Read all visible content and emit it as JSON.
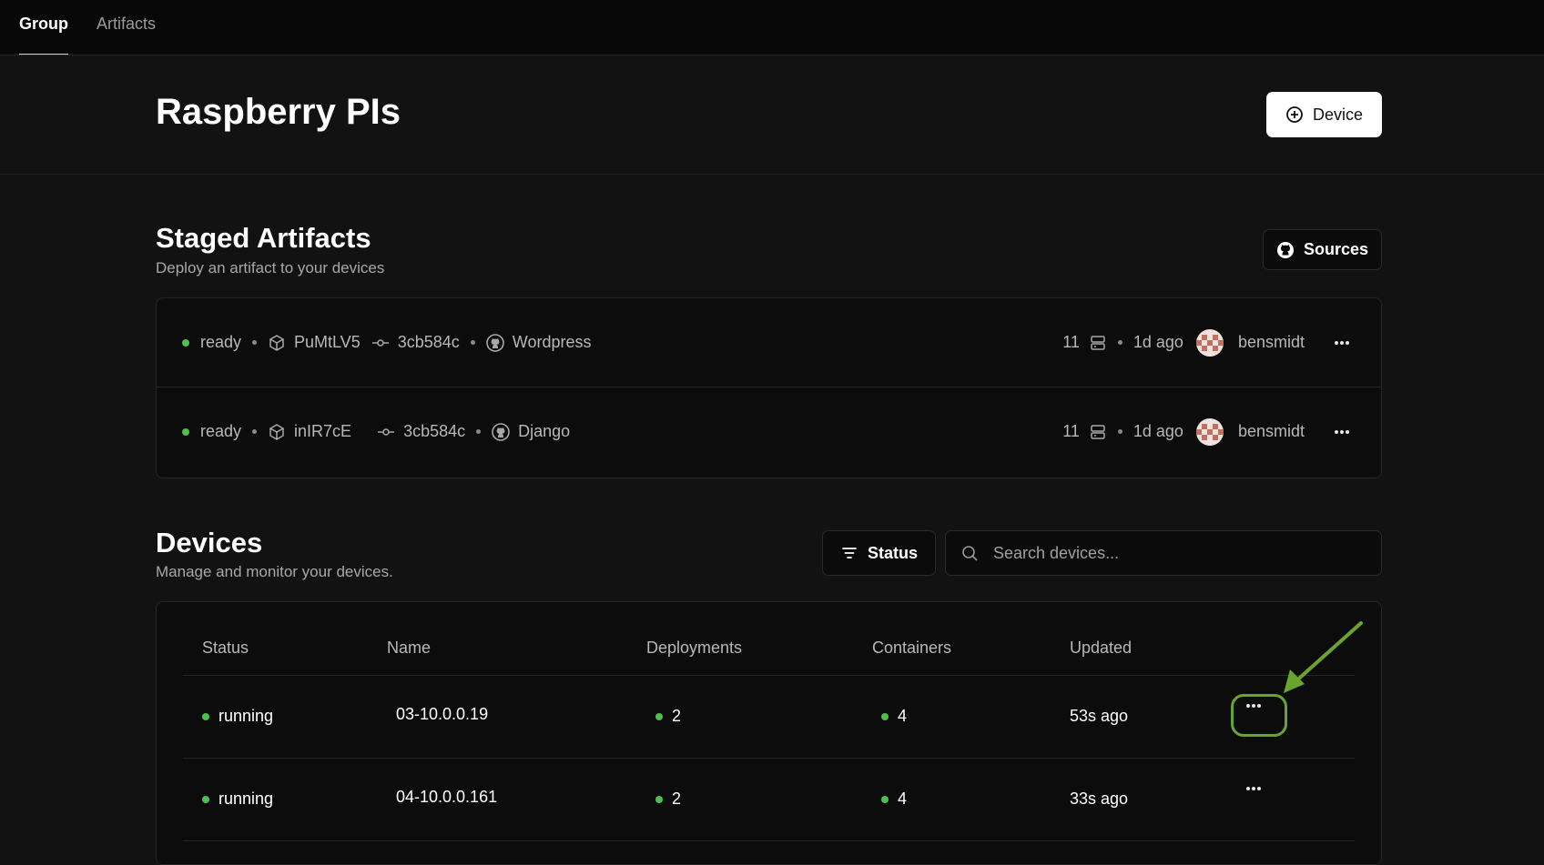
{
  "nav": {
    "tabs": [
      {
        "label": "Group",
        "active": true
      },
      {
        "label": "Artifacts",
        "active": false
      }
    ]
  },
  "header": {
    "title": "Raspberry PIs",
    "add_device_label": "Device",
    "add_device_icon": "plus-circle-icon"
  },
  "staged": {
    "title": "Staged Artifacts",
    "subtitle": "Deploy an artifact to your devices",
    "sources_label": "Sources",
    "sources_icon": "github-icon",
    "rows": [
      {
        "status": "ready",
        "artifact_id": "PuMtLV5",
        "commit": "3cb584c",
        "source": "Wordpress",
        "count": "11",
        "age": "1d ago",
        "user": "bensmidt"
      },
      {
        "status": "ready",
        "artifact_id": "inIR7cE",
        "commit": "3cb584c",
        "source": "Django",
        "count": "11",
        "age": "1d ago",
        "user": "bensmidt"
      }
    ]
  },
  "devices": {
    "title": "Devices",
    "subtitle": "Manage and monitor your devices.",
    "status_filter_label": "Status",
    "search_placeholder": "Search devices...",
    "columns": [
      "Status",
      "Name",
      "Deployments",
      "Containers",
      "Updated"
    ],
    "rows": [
      {
        "status": "running",
        "name": "03-10.0.0.19",
        "deployments": "2",
        "containers": "4",
        "updated": "53s ago"
      },
      {
        "status": "running",
        "name": "04-10.0.0.161",
        "deployments": "2",
        "containers": "4",
        "updated": "33s ago"
      }
    ]
  },
  "colors": {
    "background": "#121212",
    "status_ok": "#4fc04f",
    "annotation": "#6aa32e"
  }
}
